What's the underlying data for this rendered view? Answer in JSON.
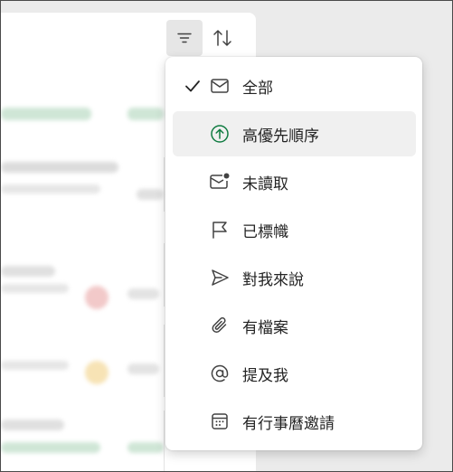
{
  "toolbar": {
    "filter_icon": "filter-icon",
    "sort_icon": "sort-icon"
  },
  "filter_menu": {
    "selected": "全部",
    "items": [
      {
        "label": "全部",
        "icon": "mail-icon",
        "checked": true
      },
      {
        "label": "高優先順序",
        "icon": "arrow-up-circle-icon",
        "highlighted": true
      },
      {
        "label": "未讀取",
        "icon": "mail-unread-icon"
      },
      {
        "label": "已標幟",
        "icon": "flag-icon"
      },
      {
        "label": "對我來說",
        "icon": "send-icon"
      },
      {
        "label": "有檔案",
        "icon": "attach-icon"
      },
      {
        "label": "提及我",
        "icon": "mention-icon"
      },
      {
        "label": "有行事曆邀請",
        "icon": "calendar-icon"
      }
    ]
  },
  "colors": {
    "accent_green": "#107c41",
    "menu_highlight": "#f0f0f0",
    "icon": "#424242"
  }
}
